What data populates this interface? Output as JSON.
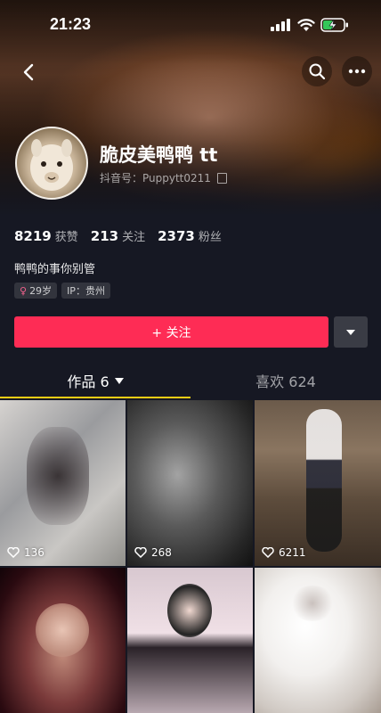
{
  "status_bar": {
    "time": "21:23"
  },
  "header": {
    "back_icon": "chevron-left-icon",
    "search_icon": "search-icon",
    "more_icon": "more-dots-icon"
  },
  "profile": {
    "nickname": "脆皮美鸭鸭 tt",
    "account_label": "抖音号：Puppytt0211",
    "stats": [
      {
        "value": "8219",
        "label": "获赞"
      },
      {
        "value": "213",
        "label": "关注"
      },
      {
        "value": "2373",
        "label": "粉丝"
      }
    ],
    "bio": "鸭鸭的事你别管",
    "tags": {
      "age": "29岁",
      "ip": "IP：贵州"
    },
    "follow_label": "+ 关注",
    "accent_color": "#fe2c55"
  },
  "tabs": [
    {
      "label": "作品 6",
      "active": true
    },
    {
      "label": "喜欢 624",
      "active": false
    }
  ],
  "videos": [
    {
      "likes": "136"
    },
    {
      "likes": "268"
    },
    {
      "likes": "6211"
    },
    {
      "likes": ""
    },
    {
      "likes": ""
    },
    {
      "likes": ""
    }
  ]
}
